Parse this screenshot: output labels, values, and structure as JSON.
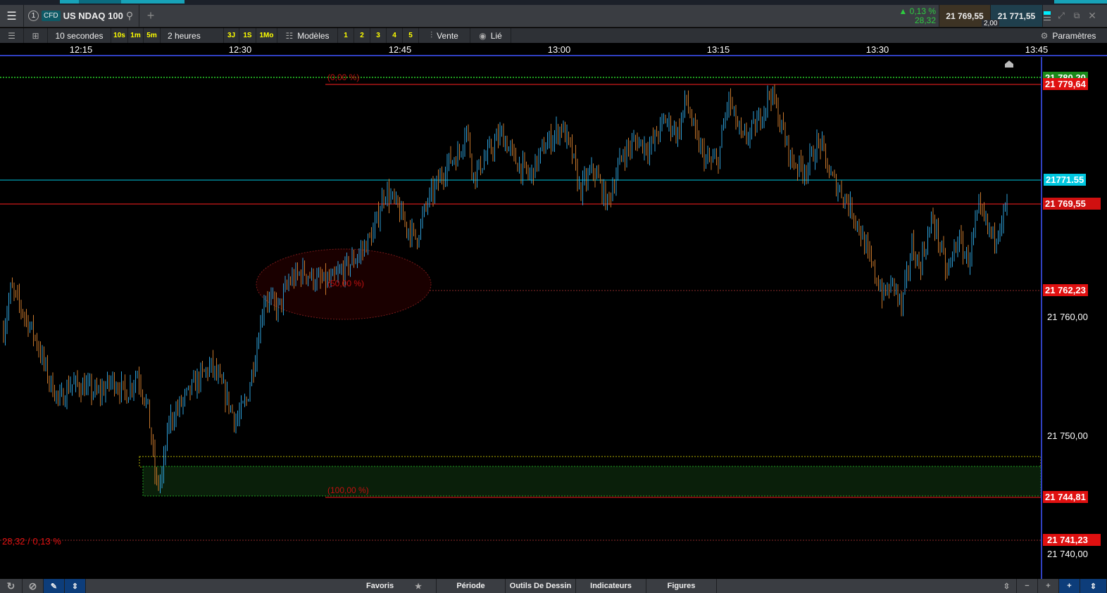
{
  "header": {
    "instrument_type": "CFD",
    "instrument_number": "1",
    "instrument": "US NDAQ 100",
    "change_pct": "0,13 %",
    "change_abs": "28,32",
    "sell_price": "21 769,55",
    "buy_price": "21 771,55",
    "spread": "2,00"
  },
  "toolbar": {
    "interval": "10 secondes",
    "quick_intervals": [
      "10s",
      "1m",
      "5m"
    ],
    "range": "2 heures",
    "quick_ranges": [
      "3J",
      "1S",
      "1Mo"
    ],
    "templates": "Modèles",
    "template_slots": [
      "1",
      "2",
      "3",
      "4",
      "5"
    ],
    "side": "Vente",
    "linked": "Lié",
    "settings": "Paramètres"
  },
  "time_axis": [
    "12:15",
    "12:30",
    "12:45",
    "13:00",
    "13:15",
    "13:30",
    "13:45"
  ],
  "price_axis": [
    "21 760,00",
    "21 750,00",
    "21 740,00"
  ],
  "price_labels": {
    "high_green": "21 780,20",
    "high": "21 779,64",
    "buy": "21771.55",
    "sell": "21 769,55",
    "mid": "21 762,23",
    "low": "21 744,81",
    "ref": "21 741,23"
  },
  "fib_labels": [
    "(0,00 %)",
    "(50,00 %)",
    "(100,00 %)"
  ],
  "change_note": "28,32 / 0,13 %",
  "bottom": {
    "favorites": "Favoris",
    "period": "Période",
    "drawing_tools": "Outils De Dessin",
    "indicators": "Indicateurs",
    "figures": "Figures"
  },
  "colors": {
    "up": "#2e9fd8",
    "down": "#c8782c",
    "sell_line": "#ff1a1a",
    "buy_line": "#00c8e0"
  },
  "chart_data": {
    "type": "candlestick",
    "interval": "10 seconds",
    "start_time": "12:07:30",
    "minutes_per_point": 0.63,
    "close_path": [
      21758.9,
      21762.4,
      21760.7,
      21758.3,
      21754.7,
      21752.9,
      21754.4,
      21754.1,
      21753.5,
      21754.7,
      21753.5,
      21755.3,
      21752.3,
      21745.8,
      21746.4,
      21751.2,
      21752.9,
      21754.7,
      21755.9,
      21753.5,
      21751.2,
      21752.9,
      21757.7,
      21761.8,
      21760.7,
      21763.0,
      21763.9,
      21763.0,
      21763.0,
      21764.2,
      21765.4,
      21767.2,
      21770.7,
      21769.6,
      21767.8,
      21766.6,
      21769.6,
      21771.3,
      21773.1,
      21773.7,
      21776.1,
      21771.9,
      21773.7,
      21775.5,
      21773.1,
      21771.9,
      21774.3,
      21776.1,
      21773.7,
      21770.7,
      21772.5,
      21769.6,
      21773.7,
      21774.9,
      21774.3,
      21776.7,
      21775.5,
      21778.5,
      21774.9,
      21773.1,
      21773.1,
      21778.5,
      21774.9,
      21776.1,
      21779.1,
      21776.1,
      21773.1,
      21772.5,
      21774.9,
      21771.9,
      21770.1,
      21768.4,
      21764.8,
      21761.8,
      21763.0,
      21760.7,
      21766.0,
      21764.2,
      21768.4,
      21763.6,
      21766.6,
      21764.8,
      21769.0,
      21766.6,
      21769.0,
      21769.9
    ],
    "path_x_minutes": [
      0,
      0.7,
      1.7,
      3,
      4.3,
      5.3,
      6.3,
      7.6,
      8.9,
      10.3,
      11.6,
      12.6,
      13.6,
      14.4,
      14.9,
      15.6,
      16.9,
      18.3,
      19.6,
      20.9,
      21.9,
      22.9,
      23.9,
      24.6,
      25.9,
      26.9,
      28.3,
      29.6,
      30.9,
      32.3,
      33.6,
      34.9,
      35.9,
      36.9,
      37.9,
      38.9,
      39.9,
      40.9,
      41.9,
      42.9,
      43.6,
      44.3,
      45.6,
      46.9,
      48.3,
      49.6,
      50.9,
      52.6,
      53.6,
      54.3,
      55.6,
      56.9,
      58.3,
      59.6,
      60.9,
      62.3,
      63.6,
      64.3,
      65.3,
      66.3,
      67.3,
      68.3,
      69.6,
      70.9,
      72.3,
      73.3,
      74.3,
      75.6,
      76.9,
      77.9,
      79.3,
      80.3,
      81.6,
      82.9,
      83.9,
      84.6,
      85.6,
      86.3,
      87.6,
      88.9,
      89.9,
      90.9,
      91.9,
      93.3,
      94.3,
      95
    ],
    "price_range": [
      21738.5,
      21782
    ]
  }
}
